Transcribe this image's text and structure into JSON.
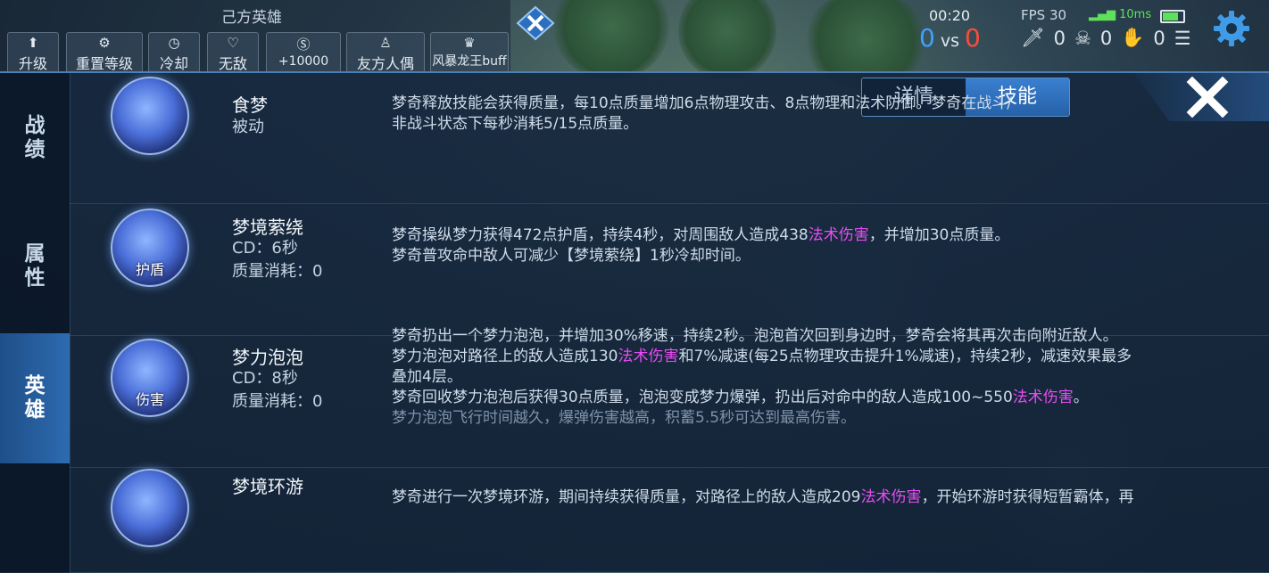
{
  "cheat_panel": {
    "title": "己方英雄",
    "buttons": [
      {
        "icon": "arrow-up-icon",
        "glyph": "⬆",
        "label": "升级"
      },
      {
        "icon": "gear-icon",
        "glyph": "⚙",
        "label": "重置等级"
      },
      {
        "icon": "clock-icon",
        "glyph": "◷",
        "label": "冷却"
      },
      {
        "icon": "heart-icon",
        "glyph": "♡",
        "label": "无敌"
      },
      {
        "icon": "coin-icon",
        "glyph": "Ⓢ",
        "label": "+10000"
      },
      {
        "icon": "puppet-icon",
        "glyph": "♙",
        "label": "友方人偶"
      },
      {
        "icon": "dragon-icon",
        "glyph": "♛",
        "label": "风暴龙王buff"
      }
    ]
  },
  "hud": {
    "time": "00:20",
    "score_blue": "0",
    "vs": "vs",
    "score_red": "0",
    "fps": "FPS 30",
    "ping": "10ms",
    "kills": "0",
    "deaths": "0",
    "assists": "0"
  },
  "sidebar": {
    "tabs": [
      "战绩",
      "属性",
      "英雄"
    ]
  },
  "tabs": [
    "详情",
    "技能"
  ],
  "skills": [
    {
      "name": "食梦",
      "meta": [
        "被动"
      ],
      "icon_tag": "",
      "desc": [
        [
          {
            "t": "梦奇释放技能会获得质量，每10点质量增加6点物理攻击、8点物理和法术防御。梦奇在战斗/"
          }
        ],
        [
          {
            "t": "非战斗状态下每秒消耗5/15点质量。"
          }
        ]
      ]
    },
    {
      "name": "梦境萦绕",
      "meta": [
        "CD：6秒",
        "质量消耗：0"
      ],
      "icon_tag": "护盾",
      "desc": [
        [
          {
            "t": "梦奇操纵梦力获得472点护盾，持续4秒，对周围敌人造成438"
          },
          {
            "t": "法术伤害",
            "c": "hl"
          },
          {
            "t": "，并增加30点质量。"
          }
        ],
        [
          {
            "t": "梦奇普攻命中敌人可减少【梦境萦绕】1秒冷却时间。"
          }
        ]
      ]
    },
    {
      "name": "梦力泡泡",
      "meta": [
        "CD：8秒",
        "质量消耗：0"
      ],
      "icon_tag": "伤害",
      "desc": [
        [
          {
            "t": "梦奇扔出一个梦力泡泡，并增加30%移速，持续2秒。泡泡首次回到身边时，梦奇会将其再次击向附近敌人。"
          }
        ],
        [
          {
            "t": "梦力泡泡对路径上的敌人造成130"
          },
          {
            "t": "法术伤害",
            "c": "hl"
          },
          {
            "t": "和7%减速(每25点物理攻击提升1%减速)，持续2秒，减速效果最多"
          }
        ],
        [
          {
            "t": "叠加4层。"
          }
        ],
        [
          {
            "t": "梦奇回收梦力泡泡后获得30点质量，泡泡变成梦力爆弹，扔出后对命中的敌人造成100~550"
          },
          {
            "t": "法术伤害",
            "c": "hl"
          },
          {
            "t": "。"
          }
        ],
        [
          {
            "t": "梦力泡泡飞行时间越久，爆弹伤害越高，积蓄5.5秒可达到最高伤害。",
            "c": "dim"
          }
        ]
      ]
    },
    {
      "name": "梦境环游",
      "meta": [],
      "icon_tag": "",
      "desc": [
        [
          {
            "t": "梦奇进行一次梦境环游，期间持续获得质量，对路径上的敌人造成209"
          },
          {
            "t": "法术伤害",
            "c": "hl"
          },
          {
            "t": "，开始环游时获得短暂霸体，再"
          }
        ]
      ]
    }
  ],
  "colors": {
    "accent": "#2d6bb0",
    "magic_damage": "#e84cf5",
    "blue_team": "#3fa0ff",
    "red_team": "#ff4a3a"
  }
}
